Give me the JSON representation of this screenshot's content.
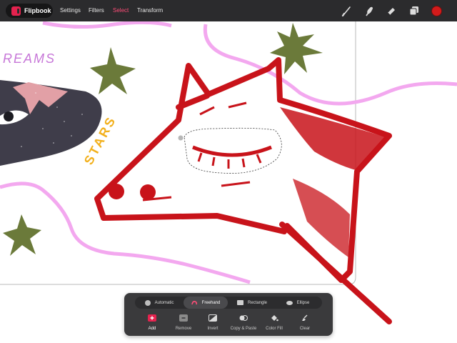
{
  "app": {
    "name": "Flipbook",
    "accent": "#e4224e"
  },
  "menu": [
    {
      "label": "Settings",
      "active": false
    },
    {
      "label": "Filters",
      "active": false
    },
    {
      "label": "Select",
      "active": true
    },
    {
      "label": "Transform",
      "active": false
    }
  ],
  "tools": [
    "brush-icon",
    "smudge-icon",
    "eraser-icon",
    "layers-icon",
    "color-picker"
  ],
  "current_color": "#d21b1b",
  "artwork_text": [
    "REAMS",
    "STARS"
  ],
  "selection_modes": {
    "items": [
      "Automatic",
      "Freehand",
      "Rectangle",
      "Ellipse"
    ],
    "selected": "Freehand"
  },
  "actions": {
    "items": [
      "Add",
      "Remove",
      "Invert",
      "Copy & Paste",
      "Color Fill",
      "Clear"
    ],
    "selected": "Add"
  }
}
